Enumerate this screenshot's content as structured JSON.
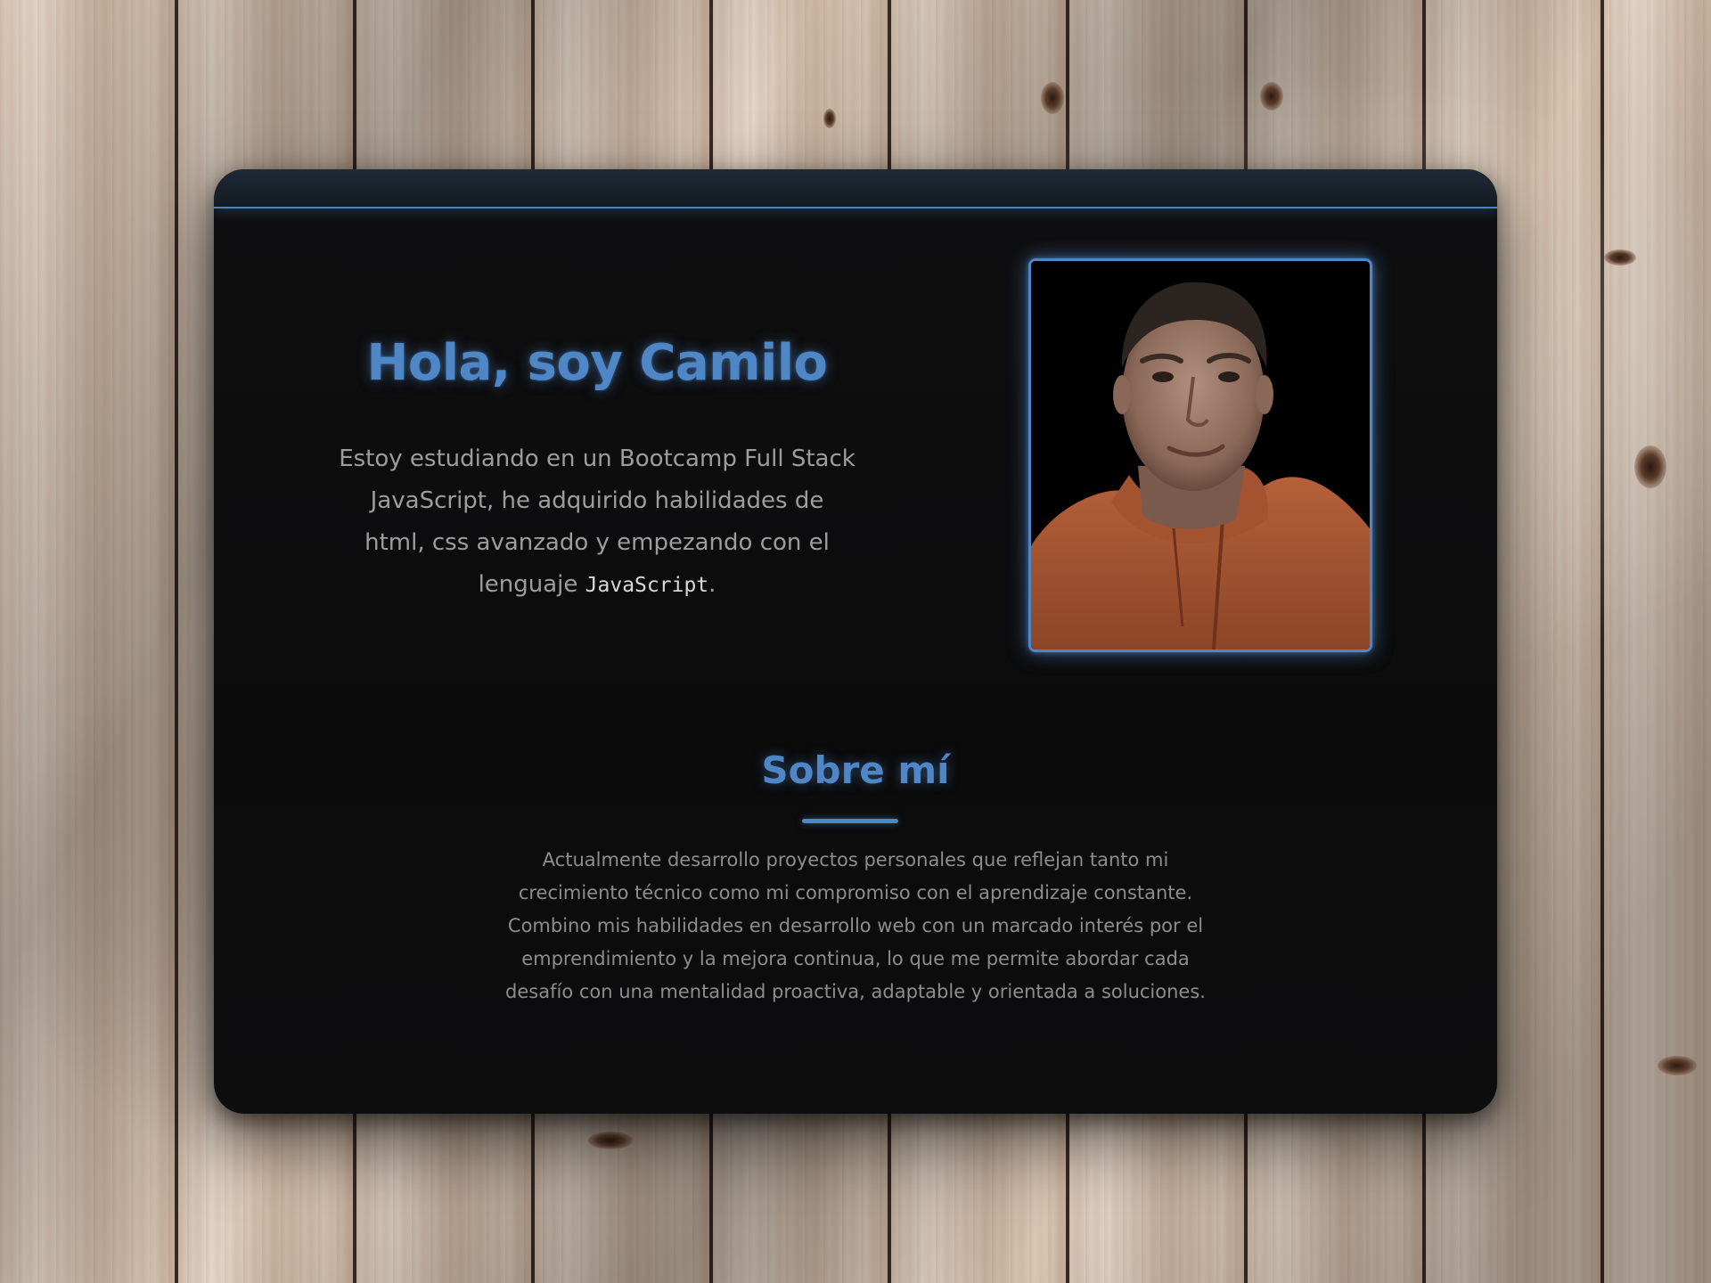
{
  "hero": {
    "title": "Hola, soy Camilo",
    "text": {
      "p1": "Estoy estudiando en un Bootcamp Full Stack JavaScript, he adquirido habilidades de html, css avanzado y empezando con el lenguaje ",
      "code": "JavaScript",
      "p2": "."
    },
    "photo_alt": "Foto de Camilo"
  },
  "about": {
    "title": "Sobre mí",
    "text": "Actualmente desarrollo proyectos personales que reflejan tanto mi crecimiento técnico como mi compromiso con el aprendizaje constante. Combino mis habilidades en desarrollo web con un marcado interés por el emprendimiento y la mejora continua, lo que me permite abordar cada desafío con una mentalidad proactiva, adaptable y orientada a soluciones."
  },
  "colors": {
    "accent": "#4f86c6",
    "card_bg": "#0f0f10",
    "text_muted": "#9d9d9d",
    "text_strong": "#d8d8d8"
  }
}
